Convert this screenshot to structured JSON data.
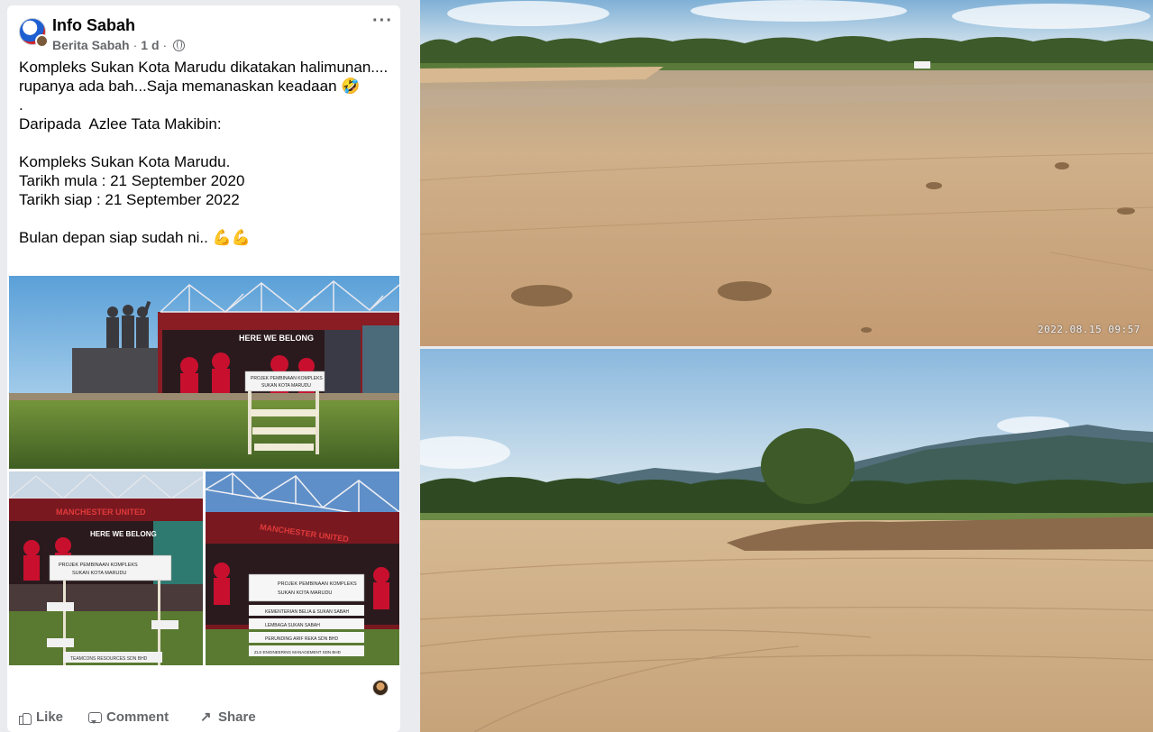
{
  "post": {
    "page_name": "Info Sabah",
    "subtitle": "Berita Sabah",
    "separator": "·",
    "time_ago": "1 d",
    "more_label": "···",
    "body_text": "Kompleks Sukan Kota Marudu dikatakan halimunan....  rupanya ada bah...Saja memanaskan keadaan 🤣\n.\nDaripada  Azlee Tata Makibin:\n\nKompleks Sukan Kota Marudu.\nTarikh mula : 21 September 2020\nTarikh siap : 21 September 2022\n\nBulan depan siap sudah ni.. 💪💪",
    "actions": {
      "like": "Like",
      "comment": "Comment",
      "share": "Share"
    }
  },
  "collage": {
    "main_sign_title": "PROJEK PEMBINAAN KOMPLEKS",
    "main_sign_sub": "SUKAN KOTA MARUDU",
    "stadium_banner": "MANCHESTER UNITED",
    "stadium_slogan": "HERE WE BELONG",
    "sign_lines": [
      "PROJEK PEMBINAAN KOMPLEKS",
      "SUKAN KOTA MARUDU",
      "KEMENTERIAN BELIA & SUKAN SABAH",
      "LEMBAGA SUKAN SABAH",
      "PERUNDING ARIF REKA SDN BHD",
      "ZLS ENGINEERING MANAGEMENT SDN BHD",
      "TEAMCONS RESOURCES SDN BHD"
    ]
  },
  "right_photos": {
    "top_timestamp": "2022.08.15 09:57"
  },
  "colors": {
    "fb_text": "#050505",
    "fb_meta": "#65676b",
    "dirt": "#c9a57a",
    "sky": "#9cc3e0",
    "mu_red": "#c8102e"
  }
}
